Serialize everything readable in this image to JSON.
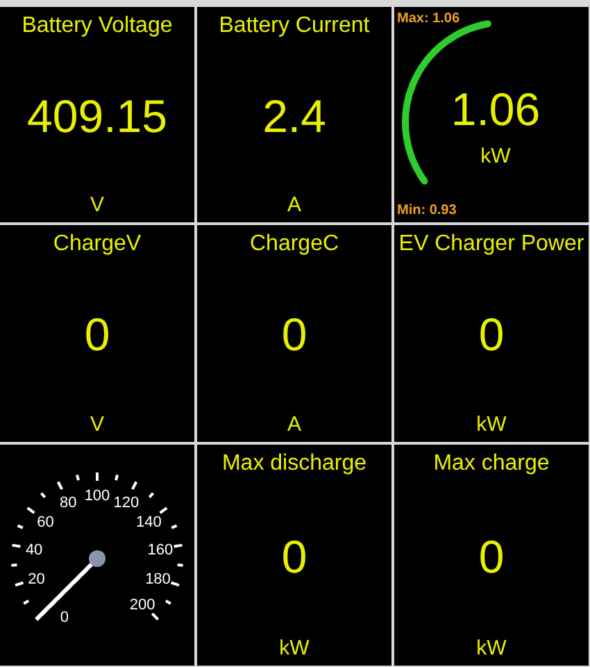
{
  "tiles": [
    {
      "kind": "value",
      "title": "Battery Voltage",
      "value": "409.15",
      "unit": "V"
    },
    {
      "kind": "value",
      "title": "Battery Current",
      "value": "2.4",
      "unit": "A"
    },
    {
      "kind": "arc",
      "max": "Max: 1.06",
      "min": "Min: 0.93",
      "value": "1.06",
      "unit": "kW"
    },
    {
      "kind": "value",
      "title": "ChargeV",
      "value": "0",
      "unit": "V"
    },
    {
      "kind": "value",
      "title": "ChargeC",
      "value": "0",
      "unit": "A"
    },
    {
      "kind": "value",
      "title": "EV Charger Power",
      "value": "0",
      "unit": "kW"
    },
    {
      "kind": "dial",
      "labels": [
        "0",
        "20",
        "40",
        "60",
        "80",
        "100",
        "120",
        "140",
        "160",
        "180",
        "200"
      ]
    },
    {
      "kind": "value",
      "title": "Max discharge",
      "value": "0",
      "unit": "kW"
    },
    {
      "kind": "value",
      "title": "Max charge",
      "value": "0",
      "unit": "kW"
    }
  ]
}
